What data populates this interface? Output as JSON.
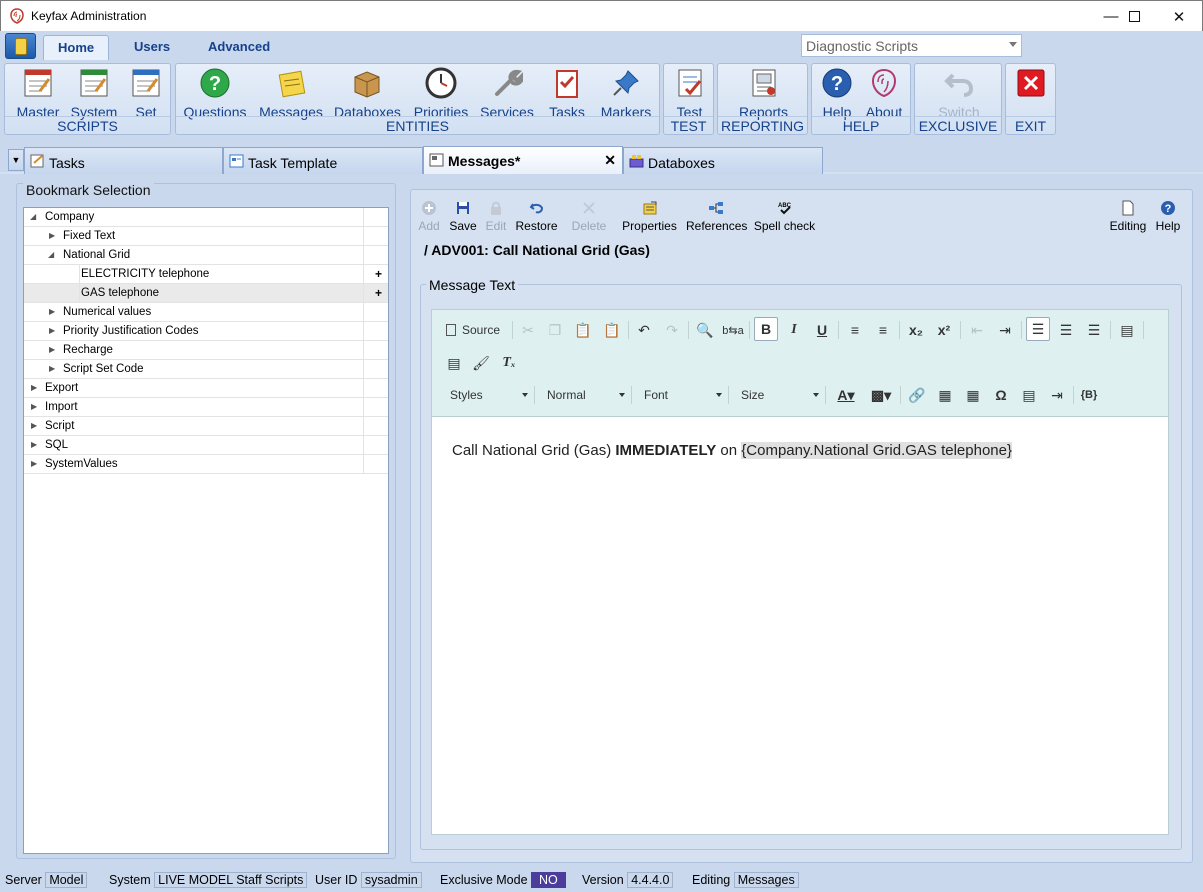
{
  "window": {
    "title": "Keyfax Administration"
  },
  "ribbon_tabs": [
    "Home",
    "Users",
    "Advanced"
  ],
  "script_type_combo": {
    "value": "Diagnostic Scripts"
  },
  "ribbon_groups": {
    "scripts": {
      "label": "SCRIPTS",
      "buttons": [
        "Master",
        "System",
        "Set"
      ]
    },
    "entities": {
      "label": "ENTITIES",
      "buttons": [
        "Questions",
        "Messages",
        "Databoxes",
        "Priorities",
        "Services",
        "Tasks",
        "Markers"
      ]
    },
    "test": {
      "label": "TEST",
      "buttons": [
        "Test"
      ]
    },
    "reporting": {
      "label": "REPORTING",
      "buttons": [
        "Reports"
      ]
    },
    "help": {
      "label": "HELP",
      "buttons": [
        "Help",
        "About"
      ]
    },
    "exclusive": {
      "label": "EXCLUSIVE",
      "buttons": [
        "Switch"
      ]
    },
    "exit": {
      "label": "EXIT"
    }
  },
  "doc_tabs": [
    "Tasks",
    "Task Template",
    "Messages*",
    "Databoxes"
  ],
  "bookmark": {
    "title": "Bookmark Selection",
    "items": [
      {
        "label": "Company"
      },
      {
        "label": "Fixed Text"
      },
      {
        "label": "National Grid"
      },
      {
        "label": "ELECTRICITY telephone"
      },
      {
        "label": "GAS telephone"
      },
      {
        "label": "Numerical values"
      },
      {
        "label": "Priority Justification Codes"
      },
      {
        "label": "Recharge"
      },
      {
        "label": "Script Set Code"
      },
      {
        "label": "Export"
      },
      {
        "label": "Import"
      },
      {
        "label": "Script"
      },
      {
        "label": "SQL"
      },
      {
        "label": "SystemValues"
      }
    ]
  },
  "toolbar": {
    "add": "Add",
    "save": "Save",
    "edit": "Edit",
    "restore": "Restore",
    "delete": "Delete",
    "properties": "Properties",
    "references": "References",
    "spell_check": "Spell check",
    "editing": "Editing",
    "help": "Help"
  },
  "message": {
    "title": "/ ADV001: Call National Grid (Gas)",
    "text_label": "Message Text",
    "content_pre": "Call National Grid (Gas) ",
    "content_bold": "IMMEDIATELY",
    "content_mid": " on ",
    "content_placeholder": "{Company.National Grid.GAS telephone}"
  },
  "editor_toolbar": {
    "source": "Source",
    "styles": "Styles",
    "format": "Normal",
    "font": "Font",
    "size": "Size"
  },
  "status": {
    "server_label": "Server",
    "server_value": "Model",
    "system_label": "System",
    "system_value": "LIVE MODEL Staff Scripts",
    "user_label": "User ID",
    "user_value": "sysadmin",
    "exclusive_label": "Exclusive Mode",
    "exclusive_value": "NO",
    "version_label": "Version",
    "version_value": "4.4.4.0",
    "editing_label": "Editing",
    "editing_value": "Messages"
  },
  "colors": {
    "accent": "#15428b",
    "background": "#c9d8ed",
    "exclusive_no": "#4b3d9b",
    "exit_red": "#e01a22"
  }
}
